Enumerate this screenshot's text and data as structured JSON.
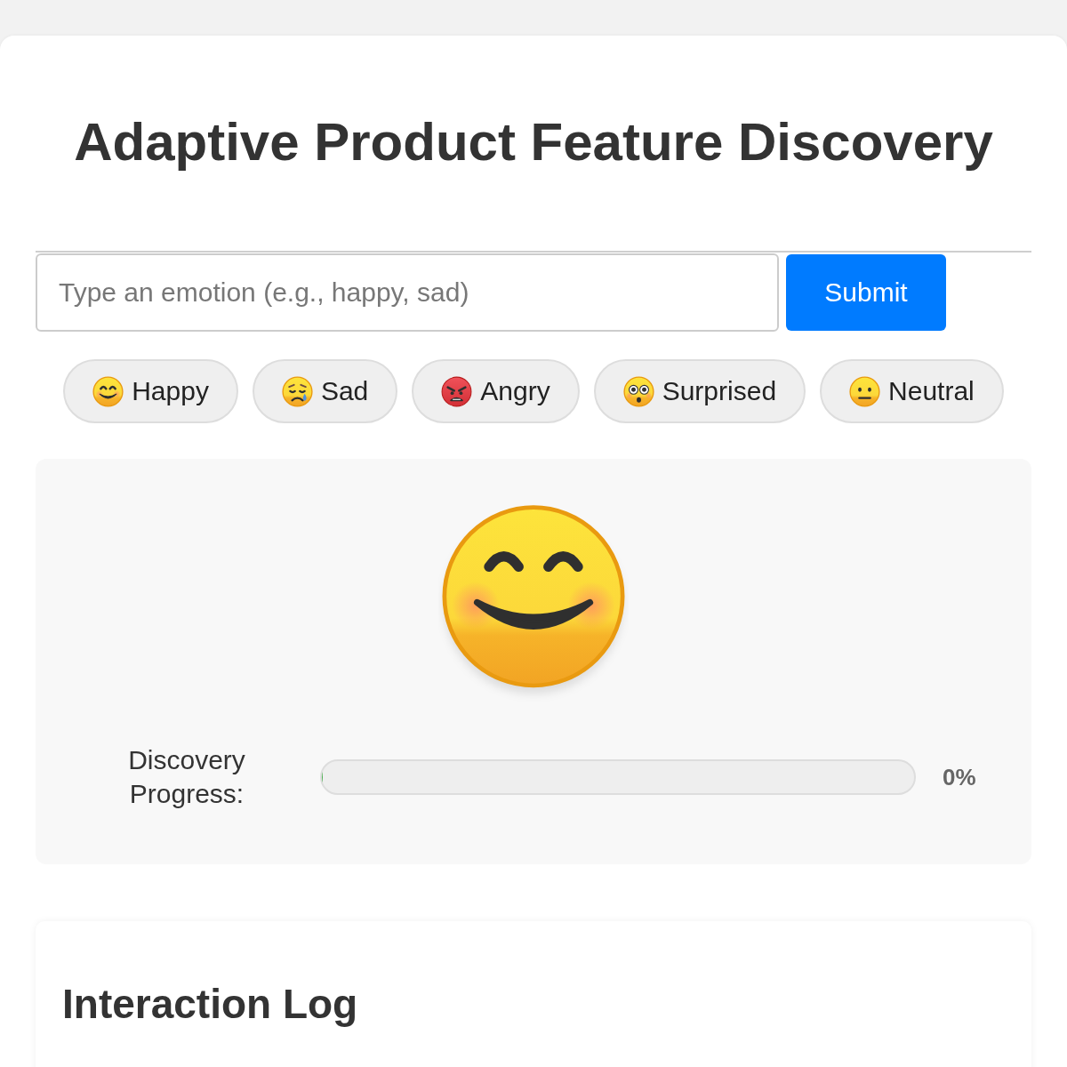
{
  "title": "Adaptive Product Feature Discovery",
  "emotion_input": {
    "placeholder": "Type an emotion (e.g., happy, sad)"
  },
  "submit_button": {
    "label": "Submit"
  },
  "emotion_buttons": [
    {
      "label": "Happy",
      "kind": "happy"
    },
    {
      "label": "Sad",
      "kind": "sad"
    },
    {
      "label": "Angry",
      "kind": "angry"
    },
    {
      "label": "Surprised",
      "kind": "surprised"
    },
    {
      "label": "Neutral",
      "kind": "neutral"
    }
  ],
  "display": {
    "kind": "happy",
    "progress": {
      "label": "Discovery Progress:",
      "level": 0,
      "reading": "0%"
    }
  },
  "interaction_log": {
    "title": "Interaction Log"
  }
}
